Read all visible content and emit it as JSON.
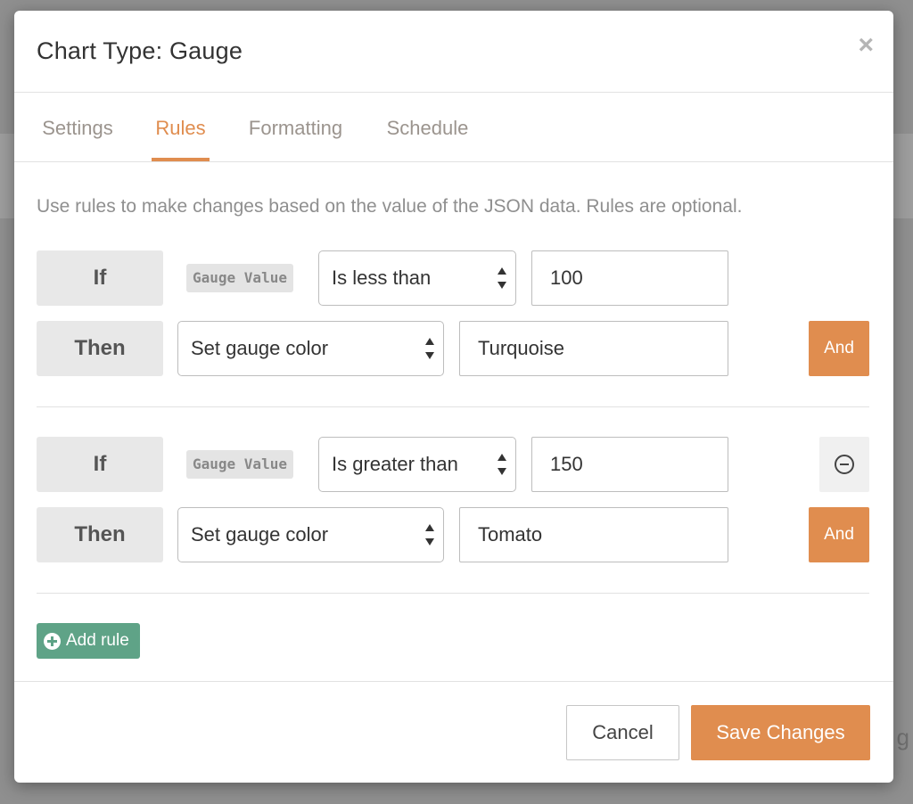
{
  "background": {
    "ghost_letter": "g"
  },
  "modal": {
    "title": "Chart Type: Gauge",
    "close_symbol": "×",
    "tabs": [
      {
        "label": "Settings",
        "active": false
      },
      {
        "label": "Rules",
        "active": true
      },
      {
        "label": "Formatting",
        "active": false
      },
      {
        "label": "Schedule",
        "active": false
      }
    ],
    "intro": "Use rules to make changes based on the value of the JSON data. Rules are optional.",
    "rules": [
      {
        "if_label": "If",
        "field": "Gauge Value",
        "operator": "Is less than",
        "value": "100",
        "then_label": "Then",
        "action": "Set gauge color",
        "action_value": "Turquoise",
        "and_label": "And",
        "removable": false
      },
      {
        "if_label": "If",
        "field": "Gauge Value",
        "operator": "Is greater than",
        "value": "150",
        "then_label": "Then",
        "action": "Set gauge color",
        "action_value": "Tomato",
        "and_label": "And",
        "removable": true
      }
    ],
    "add_rule_label": "Add rule",
    "footer": {
      "cancel_label": "Cancel",
      "save_label": "Save Changes"
    }
  },
  "colors": {
    "accent": "#e08d4f",
    "add_rule": "#5fa387",
    "overlay": "#8f8f8f"
  },
  "icons": {
    "close": "close-icon",
    "remove": "circle-minus-icon",
    "add": "plus-circle-icon",
    "select": "select-arrows-icon"
  }
}
